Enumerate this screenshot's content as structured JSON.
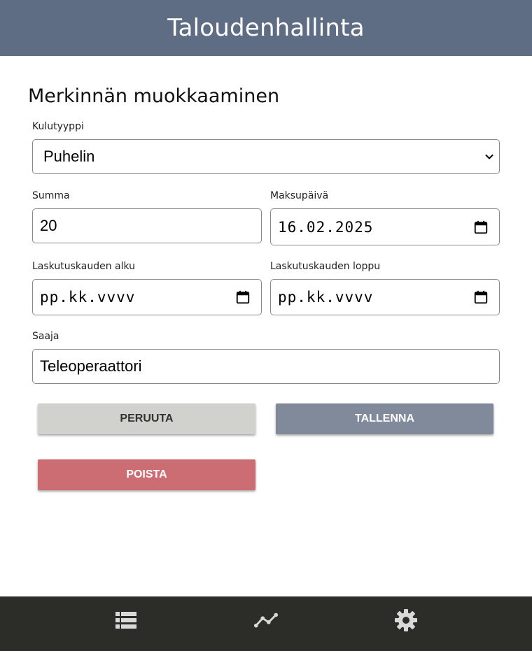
{
  "header": {
    "title": "Taloudenhallinta"
  },
  "form": {
    "heading": "Merkinnän muokkaaminen",
    "expense_type": {
      "label": "Kulutyyppi",
      "value": "Puhelin"
    },
    "amount": {
      "label": "Summa",
      "value": "20"
    },
    "payment_date": {
      "label": "Maksupäivä",
      "value": "16.02.2025"
    },
    "billing_start": {
      "label": "Laskutuskauden alku",
      "value": "pp.kk.vvvv"
    },
    "billing_end": {
      "label": "Laskutuskauden loppu",
      "value": "pp.kk.vvvv"
    },
    "payee": {
      "label": "Saaja",
      "value": "Teleoperaattori"
    }
  },
  "buttons": {
    "cancel": "PERUUTA",
    "save": "TALLENNA",
    "delete": "POISTA"
  },
  "nav": {
    "items": [
      {
        "icon": "list-icon"
      },
      {
        "icon": "trend-chart-icon"
      },
      {
        "icon": "gear-icon"
      }
    ]
  },
  "colors": {
    "header_bg": "#5f6d84",
    "nav_bg": "#2c2c29",
    "cancel_bg": "#d1d1cd",
    "save_bg": "#808a9a",
    "delete_bg": "#cc6d73",
    "nav_icon": "#d9d9d9"
  }
}
